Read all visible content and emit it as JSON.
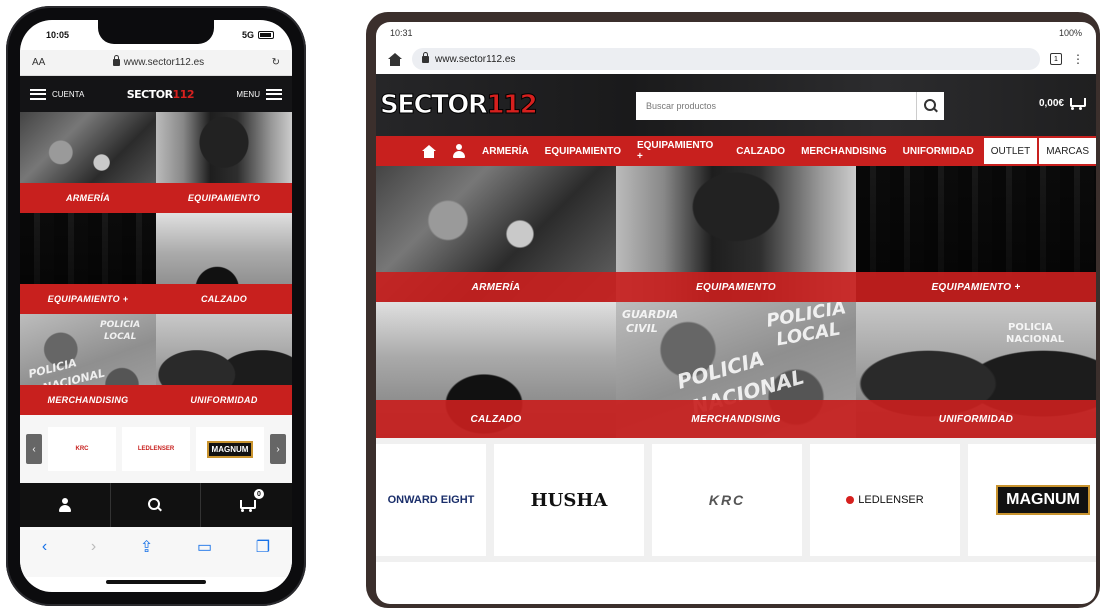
{
  "phone": {
    "status": {
      "time": "10:05",
      "network": "5G"
    },
    "browser": {
      "text_size": "AA",
      "url": "www.sector112.es",
      "reload": "↻"
    },
    "header": {
      "account_label": "CUENTA",
      "menu_label": "MENU",
      "logo_main": "SECTOR",
      "logo_accent": "112"
    },
    "categories": [
      "ARMERÍA",
      "EQUIPAMIENTO",
      "EQUIPAMIENTO +",
      "CALZADO",
      "MERCHANDISING",
      "UNIFORMIDAD"
    ],
    "brand_carousel": {
      "prev": "‹",
      "next": "›",
      "brands": [
        "KRC",
        "LEDLENSER",
        "MAGNUM"
      ]
    },
    "bottom_bar": {
      "cart_count": "0"
    },
    "safari_controls": [
      "‹",
      "›",
      "⇪",
      "▭",
      "❐"
    ]
  },
  "tablet": {
    "status": {
      "time": "10:31",
      "battery": "100%"
    },
    "browser": {
      "url": "www.sector112.es",
      "tab_count": "1",
      "menu": "⋮"
    },
    "header": {
      "logo_main": "SECTOR",
      "logo_accent": "112",
      "search_placeholder": "Buscar productos",
      "cart_total": "0,00€"
    },
    "nav": [
      "ARMERÍA",
      "EQUIPAMIENTO",
      "EQUIPAMIENTO +",
      "CALZADO",
      "MERCHANDISING",
      "UNIFORMIDAD"
    ],
    "nav_extra": [
      "OUTLET",
      "MARCAS"
    ],
    "categories": [
      "ARMERÍA",
      "EQUIPAMIENTO",
      "EQUIPAMIENTO +",
      "CALZADO",
      "MERCHANDISING",
      "UNIFORMIDAD"
    ],
    "photo_texts": {
      "policia": "POLICIA",
      "local": "LOCAL",
      "nacional": "NACIONAL",
      "guardia": "GUARDIA",
      "civil": "CIVIL"
    },
    "brands": [
      "ONWARD EIGHT",
      "HUSHA",
      "KRC",
      "LEDLENSER",
      "MAGNUM"
    ]
  },
  "colors": {
    "brand_red": "#c8201e",
    "header_dark": "#1c1c1e"
  }
}
